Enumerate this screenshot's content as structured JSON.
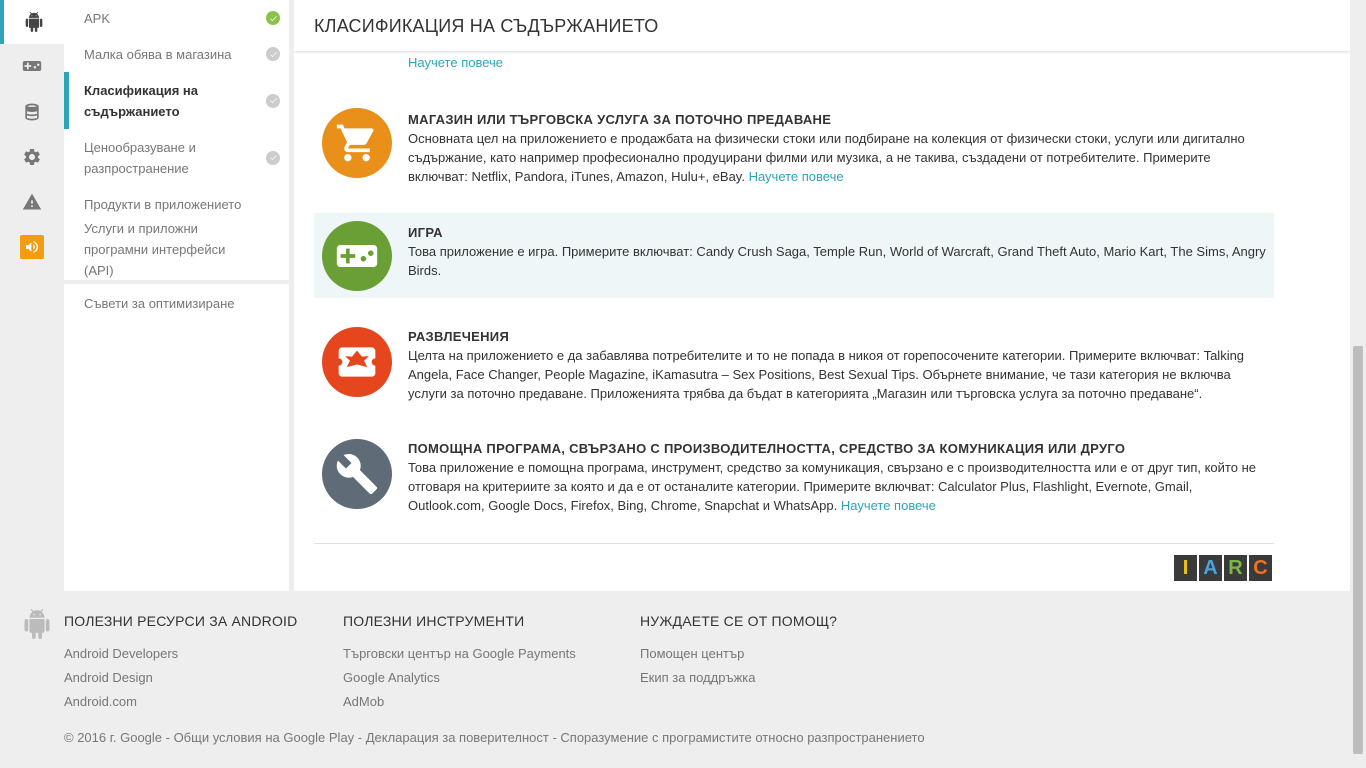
{
  "header": {
    "title": "КЛАСИФИКАЦИЯ НА СЪДЪРЖАНИЕТО"
  },
  "rail": [
    {
      "icon": "android-icon",
      "active": true
    },
    {
      "icon": "gamepad-icon"
    },
    {
      "icon": "database-icon"
    },
    {
      "icon": "gear-icon"
    },
    {
      "icon": "warning-icon"
    },
    {
      "icon": "megaphone-icon"
    }
  ],
  "subnav": {
    "items": [
      {
        "label": "APK",
        "status": "complete"
      },
      {
        "label": "Малка обява в магазина",
        "status": "done"
      },
      {
        "label": "Класификация на съдържанието",
        "status": "done",
        "active": true
      },
      {
        "label": "Ценообразуване и разпространение",
        "status": "done"
      },
      {
        "label": "Продукти в приложението"
      },
      {
        "label": "Услуги и приложни програмни интерфейси (API)"
      }
    ],
    "tips": "Съвети за оптимизиране"
  },
  "content": {
    "learn_more": "Научете повече",
    "categories": [
      {
        "title": "МАГАЗИН ИЛИ ТЪРГОВСКА УСЛУГА ЗА ПОТОЧНО ПРЕДАВАНЕ",
        "text": "Основната цел на приложението е продажбата на физически стоки или подбиране на колекция от физически стоки, услуги или дигитално съдържание, като например професионално продуцирани филми или музика, а не такива, създадени от потребителите. Примерите включват: Netflix, Pandora, iTunes, Amazon, Hulu+, eBay.",
        "icon": "cart-icon",
        "color": "#e8901a"
      },
      {
        "title": "ИГРА",
        "text": "Това приложение е игра. Примерите включват: Candy Crush Saga, Temple Run, World of Warcraft, Grand Theft Auto, Mario Kart, The Sims, Angry Birds.",
        "icon": "gamepad-icon",
        "color": "#6a9f35",
        "selected": true
      },
      {
        "title": "РАЗВЛЕЧЕНИЯ",
        "text": "Целта на приложението е да забавлява потребителите и то не попада в никоя от горепосочените категории. Примерите включват: Talking Angela, Face Changer, People Magazine, iKamasutra – Sex Positions, Best Sexual Tips. Обърнете внимание, че тази категория не включва услуги за поточно предаване. Приложенията трябва да бъдат в категорията „Магазин или търговска услуга за поточно предаване“.",
        "icon": "ticket-icon",
        "color": "#e6461e"
      },
      {
        "title": "ПОМОЩНА ПРОГРАМА, СВЪРЗАНО С ПРОИЗВОДИТЕЛНОСТТА, СРЕДСТВО ЗА КОМУНИКАЦИЯ ИЛИ ДРУГО",
        "text": "Това приложение е помощна програма, инструмент, средство за комуникация, свързано е с производителността или е от друг тип, който не отговаря на критериите за която и да е от останалите категории. Примерите включват: Calculator Plus, Flashlight, Evernote, Gmail, Outlook.com, Google Docs, Firefox, Bing, Chrome, Snapchat и WhatsApp.",
        "icon": "wrench-icon",
        "color": "#5f6b77"
      }
    ],
    "iarc": [
      "I",
      "A",
      "R",
      "C"
    ],
    "iarc_colors": [
      "#f1c40f",
      "#4aa3df",
      "#7ab648",
      "#f36f21"
    ]
  },
  "footer": {
    "col1": {
      "title": "ПОЛЕЗНИ РЕСУРСИ ЗА ANDROID",
      "links": [
        "Android Developers",
        "Android Design",
        "Android.com"
      ]
    },
    "col2": {
      "title": "ПОЛЕЗНИ ИНСТРУМЕНТИ",
      "links": [
        "Търговски център на Google Payments",
        "Google Analytics",
        "AdMob"
      ]
    },
    "col3": {
      "title": "НУЖДАЕТЕ СЕ ОТ ПОМОЩ?",
      "links": [
        "Помощен център",
        "Екип за поддръжка"
      ]
    },
    "copyright": "© 2016 г. Google - Общи условия на Google Play - Декларация за поверителност - Споразумение с програмистите относно разпространението"
  },
  "colors": {
    "accent": "#2da4b8",
    "selected_bg": "#eff6f8"
  }
}
